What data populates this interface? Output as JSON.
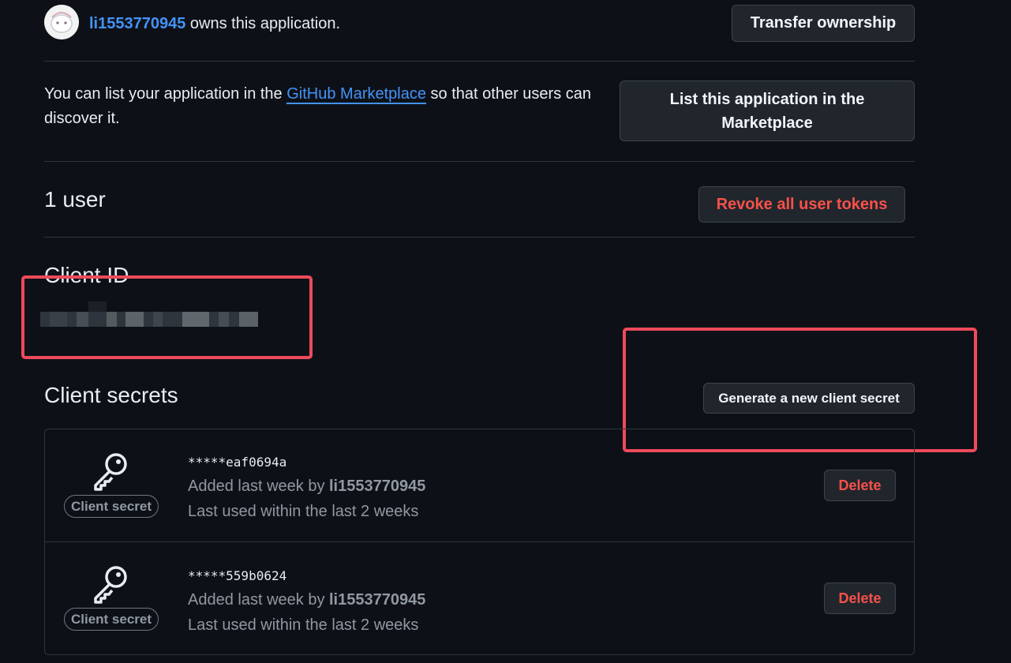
{
  "owner": {
    "username": "li1553770945",
    "suffix": " owns this application.",
    "transfer_button": "Transfer ownership"
  },
  "marketplace": {
    "text_before": "You can list your application in the ",
    "link_text": "GitHub Marketplace",
    "text_after": " so that other users can discover it.",
    "button": "List this application in the Marketplace"
  },
  "users": {
    "count_label": "1 user",
    "revoke_button": "Revoke all user tokens"
  },
  "client_id": {
    "heading": "Client ID",
    "value_redacted": true
  },
  "client_secrets": {
    "heading": "Client secrets",
    "generate_button": "Generate a new client secret",
    "items": [
      {
        "label": "Client secret",
        "masked": "*****eaf0694a",
        "added_prefix": "Added last week by ",
        "added_by": "li1553770945",
        "last_used": "Last used within the last 2 weeks",
        "delete_button": "Delete"
      },
      {
        "label": "Client secret",
        "masked": "*****559b0624",
        "added_prefix": "Added last week by ",
        "added_by": "li1553770945",
        "last_used": "Last used within the last 2 weeks",
        "delete_button": "Delete"
      }
    ]
  },
  "colors": {
    "background": "#0d1117",
    "link": "#4493f8",
    "danger": "#f85149",
    "annotation": "#ee4a5c"
  }
}
